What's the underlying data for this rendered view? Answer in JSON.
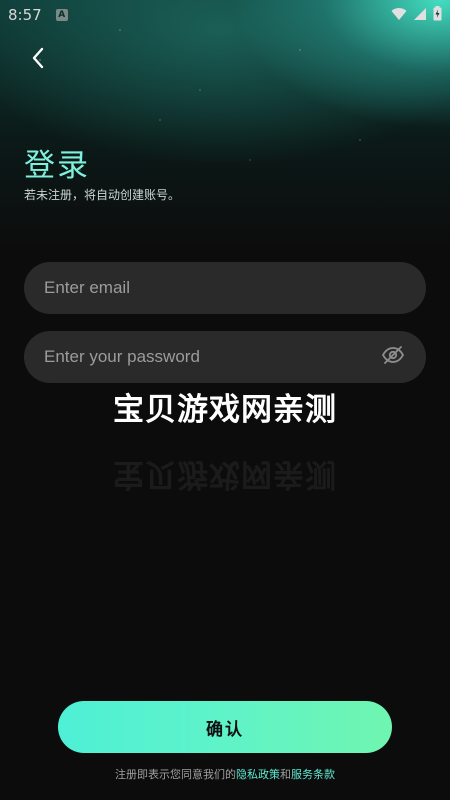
{
  "status_bar": {
    "time": "8:57",
    "notification_letter": "A",
    "icons": [
      "wifi-icon",
      "cell-signal-icon",
      "battery-charging-icon"
    ]
  },
  "header": {
    "back_icon": "chevron-left-icon",
    "title": "登录",
    "subtitle": "若未注册，将自动创建账号。"
  },
  "form": {
    "email": {
      "value": "",
      "placeholder": "Enter email"
    },
    "password": {
      "value": "",
      "placeholder": "Enter your password",
      "toggle_icon": "eye-off-icon"
    }
  },
  "watermark": "宝贝游戏网亲测",
  "confirm": {
    "label": "确认"
  },
  "agreement": {
    "prefix": "注册即表示您同意我们的",
    "privacy_link": "隐私政策",
    "joiner": "和",
    "terms_link": "服务条款"
  },
  "colors": {
    "accent": "#5fe9d2",
    "title": "#7ff0dc",
    "background": "#0c0c0c",
    "field_bg": "#2a2a2a",
    "button_gradient": [
      "#4ef0d6",
      "#6ff5b0"
    ]
  }
}
